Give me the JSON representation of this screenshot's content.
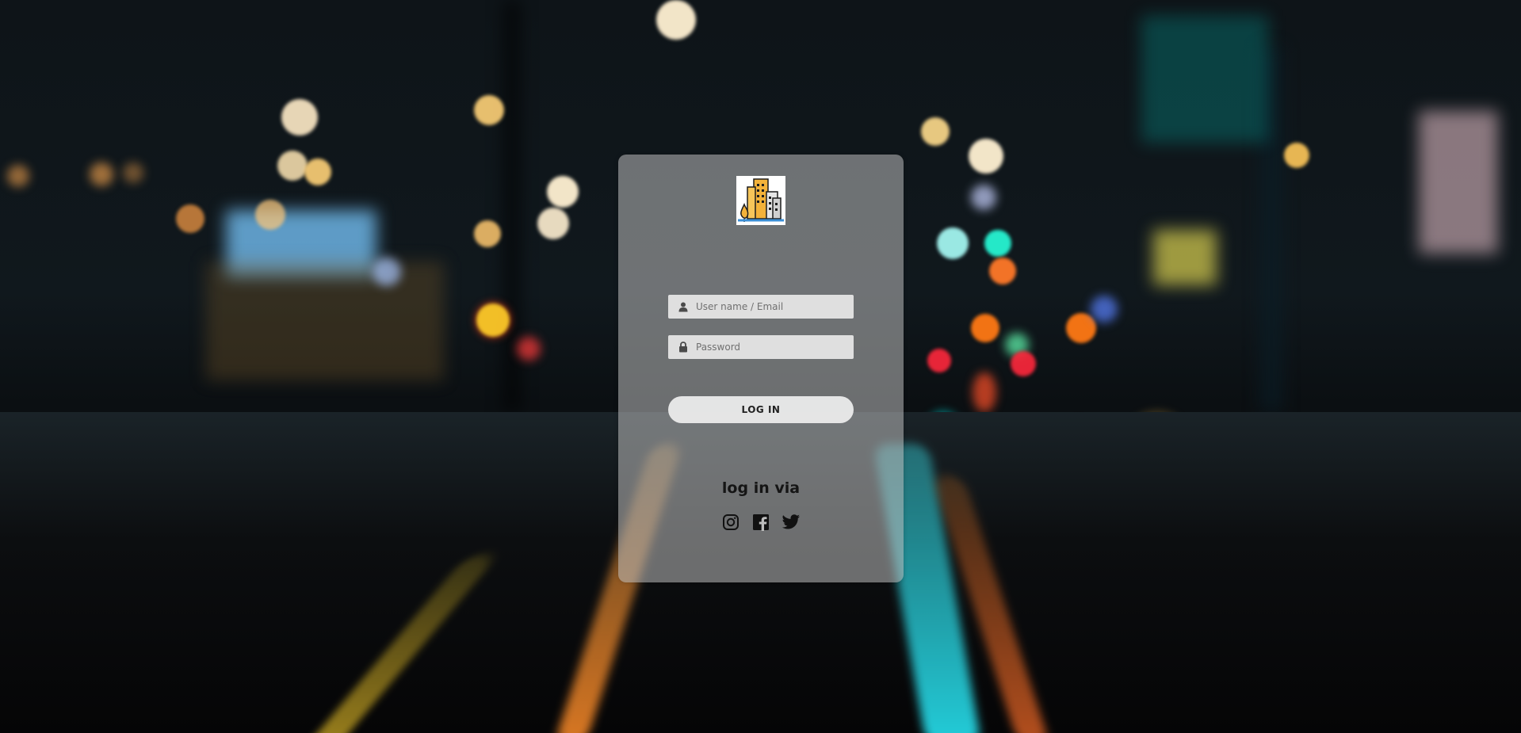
{
  "login": {
    "username_placeholder": "User name / Email",
    "password_placeholder": "Password",
    "login_button": "LOG IN",
    "via_label": "log in via"
  },
  "icons": {
    "username": "user-icon",
    "password": "lock-icon",
    "socials": [
      "instagram-icon",
      "facebook-icon",
      "twitter-icon"
    ]
  },
  "colors": {
    "card": "#bebebe",
    "input_background": "#ebebeb",
    "text": "#151515"
  }
}
